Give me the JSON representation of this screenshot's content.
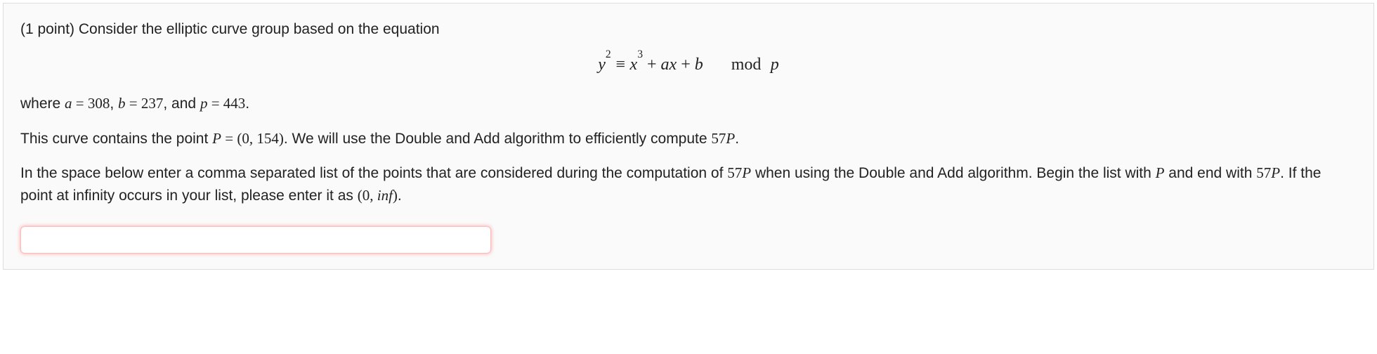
{
  "problem": {
    "points_label": "(1 point)",
    "intro": "Consider the elliptic curve group based on the equation",
    "equation": {
      "lhs_var": "y",
      "lhs_exp": "2",
      "equiv": "≡",
      "rhs_var": "x",
      "rhs_exp": "3",
      "plus1": " + ",
      "rhs_term2a": "a",
      "rhs_term2x": "x",
      "plus2": " + ",
      "rhs_term3": "b",
      "mod_label": "mod",
      "mod_var": "p"
    },
    "where": {
      "prefix": "where ",
      "a_var": "a",
      "eq1": " = ",
      "a_val": "308",
      "sep1": ", ",
      "b_var": "b",
      "eq2": " = ",
      "b_val": "237",
      "sep2": ", and ",
      "p_var": "p",
      "eq3": " = ",
      "p_val": "443",
      "tail": "."
    },
    "contains": {
      "t1": "This curve contains the point ",
      "P": "P",
      "eq": " = ",
      "pt": "(0, 154)",
      "t2": ". We will use the Double and Add algorithm to efficiently compute ",
      "mult": "57",
      "P2": "P",
      "tail": "."
    },
    "instr": {
      "t1": "In the space below enter a comma separated list of the points that are considered during the computation of ",
      "mult": "57",
      "P": "P",
      "t2": " when using the Double and Add algorithm. Begin the list with ",
      "P2": "P",
      "t3": " and end with ",
      "mult2": "57",
      "P3": "P",
      "t4": ". If the point at infinity occurs in your list, please enter it as ",
      "inf_open": "(0, ",
      "inf_var": "in",
      "inf_var2": "f",
      "inf_close": ")",
      "tail": "."
    },
    "answer_value": ""
  }
}
